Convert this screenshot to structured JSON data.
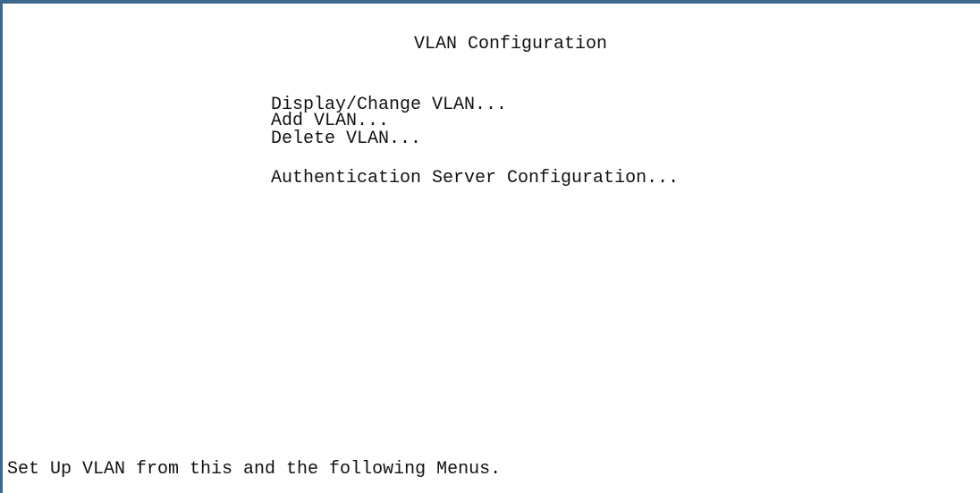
{
  "screen": {
    "title": "VLAN Configuration",
    "menu_items": [
      {
        "label": "Display/Change VLAN..."
      },
      {
        "label": "Add VLAN..."
      },
      {
        "label": "Delete VLAN..."
      },
      {
        "label": "Authentication Server Configuration..."
      }
    ],
    "status_text": "Set Up VLAN from this and the following Menus."
  },
  "colors": {
    "border": "#3d6a8c",
    "background": "#ffffff",
    "text": "#111111"
  }
}
